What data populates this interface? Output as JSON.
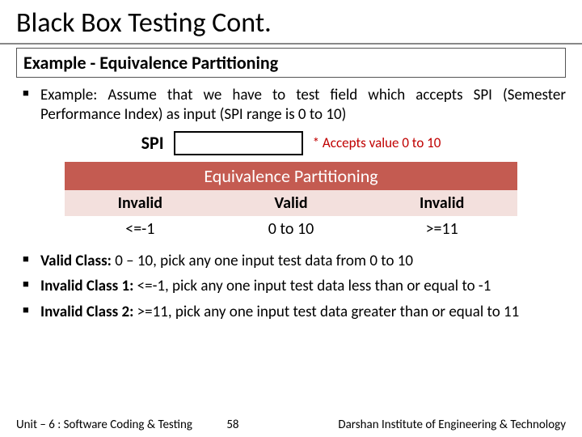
{
  "title": "Black Box Testing Cont.",
  "subtitle": "Example - Equivalence Partitioning",
  "bullets_top": [
    "Example: Assume that we have to test field which accepts SPI (Semester Performance Index) as input (SPI range is 0 to 10)"
  ],
  "spi": {
    "label": "SPI",
    "note": "* Accepts value 0 to 10"
  },
  "eq_title": "Equivalence Partitioning",
  "eq_headers": [
    "Invalid",
    "Valid",
    "Invalid"
  ],
  "eq_values": [
    "<=-1",
    "0 to 10",
    ">=11"
  ],
  "bullets_bottom": [
    {
      "bold": "Valid Class:",
      "rest": " 0 – 10, pick any one input test data from 0 to 10"
    },
    {
      "bold": "Invalid Class 1:",
      "rest": " <=-1, pick any one input test data less than or equal to -1"
    },
    {
      "bold": "Invalid Class 2:",
      "rest": " >=11, pick any one input test data greater than or equal to 11"
    }
  ],
  "footer": {
    "unit": "Unit – 6 : Software Coding & Testing",
    "page": "58",
    "institute": "Darshan Institute of Engineering & Technology"
  }
}
